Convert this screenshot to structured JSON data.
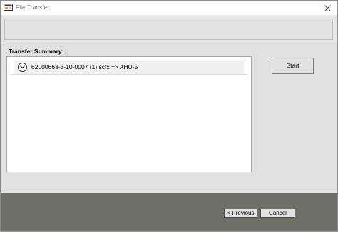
{
  "window": {
    "title": "File Transfer",
    "close_icon": "close-icon",
    "app_icon": "file-transfer-app-icon"
  },
  "summary": {
    "label": "Transfer Summary:",
    "items": [
      {
        "text": "62000663-3-10-0007 (1).scfx => AHU-5",
        "icon": "chevron-down-icon"
      }
    ]
  },
  "actions": {
    "start_label": "Start"
  },
  "footer": {
    "previous_label": "< Previous",
    "cancel_label": "Cancel"
  },
  "colors": {
    "footer_bg": "#6f6f6a",
    "content_bg": "#e1e1e1",
    "title_text": "#7d7d7d"
  }
}
